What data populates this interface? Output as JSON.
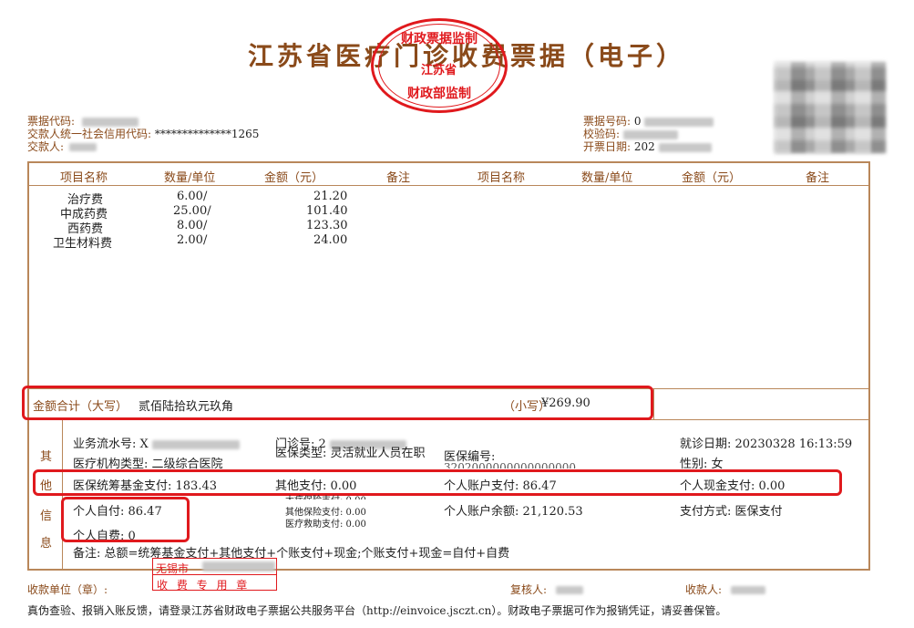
{
  "header": {
    "title": "江苏省医疗门诊收费票据（电子）",
    "stamp_top": "财政票据监制",
    "stamp_mid": "江苏省",
    "stamp_bottom": "财政部监制"
  },
  "meta_left": {
    "code_label": "票据代码:",
    "credit_label": "交款人统一社会信用代码:",
    "credit_value": "**************1265",
    "payer_label": "交款人:"
  },
  "meta_right": {
    "number_label": "票据号码:",
    "number_value": "0",
    "check_label": "校验码:",
    "date_label": "开票日期:",
    "date_value": "202"
  },
  "table": {
    "headers": [
      "项目名称",
      "数量/单位",
      "金额（元）",
      "备注",
      "项目名称",
      "数量/单位",
      "金额（元）",
      "备注"
    ],
    "rows": [
      {
        "name": "治疗费",
        "qty": "6.00/",
        "amount": "21.20"
      },
      {
        "name": "中成药费",
        "qty": "25.00/",
        "amount": "101.40"
      },
      {
        "name": "西药费",
        "qty": "8.00/",
        "amount": "123.30"
      },
      {
        "name": "卫生材料费",
        "qty": "2.00/",
        "amount": "24.00"
      }
    ]
  },
  "total": {
    "label": "金额合计（大写）",
    "upper": "贰佰陆拾玖元玖角",
    "small_label": "（小写）",
    "small_value": "¥269.90"
  },
  "other": {
    "side_chars": [
      "其",
      "他",
      "信",
      "息"
    ],
    "serial_label": "业务流水号:",
    "serial_value": "X",
    "clinic_no_label": "门诊号:",
    "clinic_no_value": "2",
    "visit_date": "就诊日期: 20230328 16:13:59",
    "org_type": "医疗机构类型: 二级综合医院",
    "insurance_type": "医保类型: 灵活就业人员在职",
    "insurance_no_label": "医保编号:",
    "insurance_no_value": "3202000000000000000",
    "gender": "性别: 女",
    "fund_pay": "医保统筹基金支付: 183.43",
    "other_pay": "其他支付: 0.00",
    "account_pay": "个人账户支付: 86.47",
    "cash_pay": "个人现金支付: 0.00",
    "self_pay": "个人自付: 86.47",
    "big_ins": "大病保险支付: 0.00",
    "other_ins": "其他保险支付: 0.00",
    "aid_pay": "医疗救助支付: 0.00",
    "balance": "个人账户余额: 21,120.53",
    "pay_method": "支付方式: 医保支付",
    "self_expense": "个人自费: 0",
    "note": "备注: 总额=统筹基金支付+其他支付+个账支付+现金;个账支付+现金=自付+自费"
  },
  "footer": {
    "payee_unit_label": "收款单位（章）:",
    "city": "无锡市",
    "fee_stamp": "收 费 专 用 章",
    "reviewer_label": "复核人:",
    "cashier_label": "收款人:",
    "notice": "真伪查验、报销入账反馈，请登录江苏省财政电子票据公共服务平台（http://einvoice.jsczt.cn）。财政电子票据可作为报销凭证，请妥善保管。"
  }
}
